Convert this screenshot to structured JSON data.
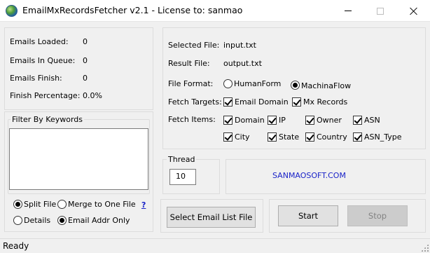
{
  "window": {
    "title": "EmailMxRecordsFetcher v2.1 - License to: sanmao"
  },
  "stats": {
    "emails_loaded_label": "Emails Loaded:",
    "emails_loaded_value": "0",
    "emails_in_queue_label": "Emails In Queue:",
    "emails_in_queue_value": "0",
    "emails_finish_label": "Emails Finish:",
    "emails_finish_value": "0",
    "finish_percentage_label": "Finish Percentage:",
    "finish_percentage_value": "0.0%"
  },
  "filter": {
    "title": "Filter By Keywords",
    "keywords_value": "",
    "split_file_label": "Split File",
    "merge_label": "Merge to One File",
    "help_label": "?",
    "details_label": "Details",
    "email_only_label": "Email Addr Only",
    "split_mode_selected": "Split File",
    "detail_mode_selected": "Email Addr Only"
  },
  "files": {
    "selected_label": "Selected File:",
    "selected_value": "input.txt",
    "result_label": "Result File:",
    "result_value": "output.txt"
  },
  "format": {
    "label": "File Format:",
    "options": [
      "HumanForm",
      "MachinaFlow"
    ],
    "selected": "MachinaFlow"
  },
  "targets": {
    "label": "Fetch Targets:",
    "email_domain": "Email Domain",
    "mx_records": "Mx Records"
  },
  "items": {
    "label": "Fetch Items:",
    "domain": "Domain",
    "ip": "IP",
    "owner": "Owner",
    "asn": "ASN",
    "city": "City",
    "state": "State",
    "country": "Country",
    "asn_type": "ASN_Type"
  },
  "thread": {
    "title": "Thread",
    "value": "10"
  },
  "brand": {
    "link": "SANMAOSOFT.COM",
    "link_color": "#1a23c8"
  },
  "actions": {
    "select_file": "Select Email List File",
    "start": "Start",
    "stop": "Stop"
  },
  "status": {
    "text": "Ready"
  }
}
